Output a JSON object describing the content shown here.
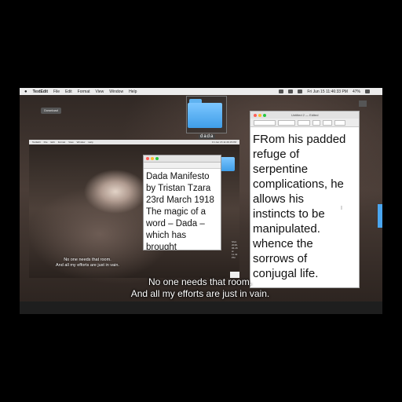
{
  "outer_menubar": {
    "apple": "",
    "app_name": "TextEdit",
    "menus": [
      "File",
      "Edit",
      "Format",
      "View",
      "Window",
      "Help"
    ],
    "clock": "Fri Jun 15  11:46:33 PM",
    "battery": "47%"
  },
  "desktop": {
    "download_chip": "Download",
    "folder_label": "dada"
  },
  "inner_screen": {
    "menubar": {
      "app_name": "TextEdit",
      "menus": [
        "File",
        "Edit",
        "Format",
        "View",
        "Window",
        "Help"
      ],
      "clock": "Fri Jun 15  11:46:15 PM"
    },
    "meta": "Shot 2018-06-15 at 11.42 PM",
    "subtitle": "No one needs that room.\nAnd all my efforts are just in vain."
  },
  "small_window": {
    "text": "Dada Manifesto\nby Tristan Tzara\n23rd March 1918\nThe magic of a\nword – Dada –\nwhich has\nbrought\njournalists to the"
  },
  "big_window": {
    "title": "Untitled 2 — Edited",
    "text": "FRom his padded\nrefuge of\nserpentine\ncomplications, he\nallows his\ninstincts to be\nmanipulated.\nwhence the\nsorrows of\nconjugal life."
  },
  "subtitle": "No one needs that room.\nAnd all my efforts are just in vain."
}
